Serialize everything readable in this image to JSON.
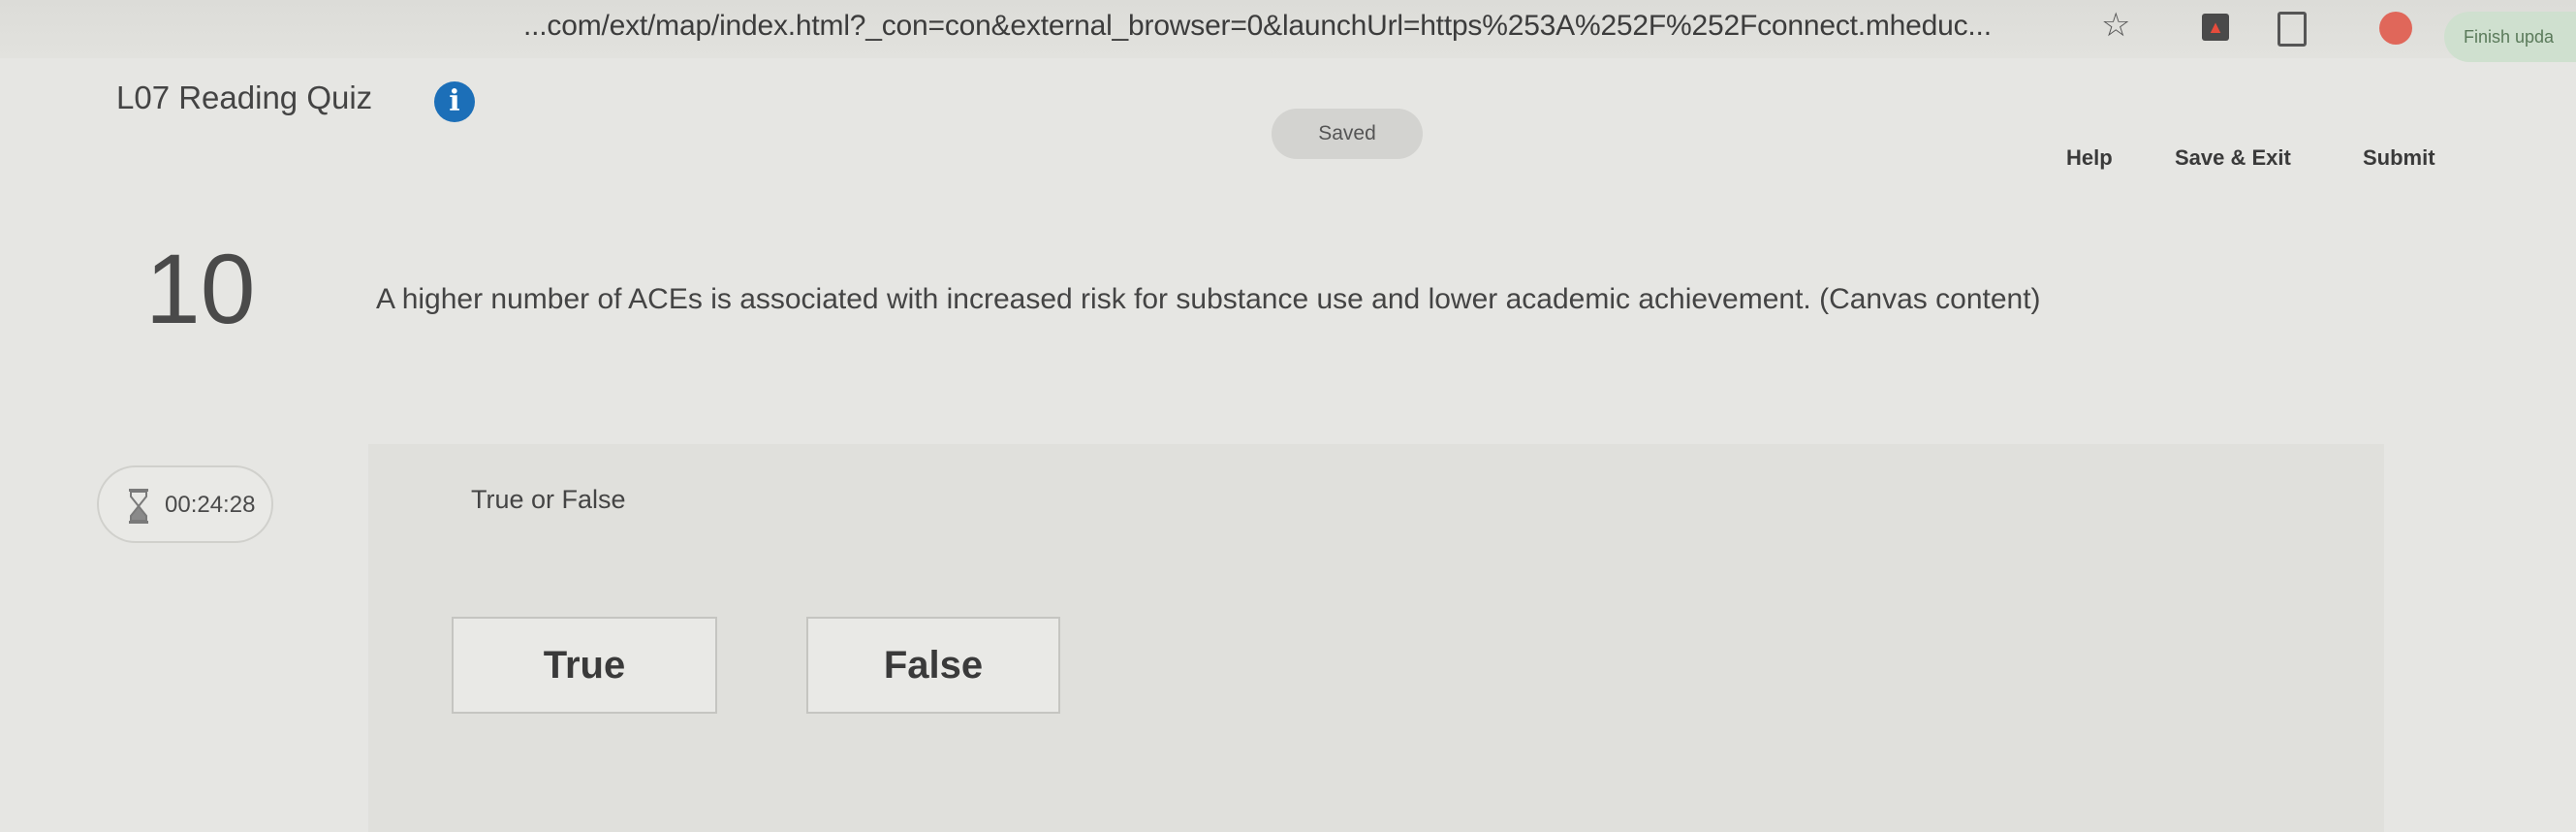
{
  "browser": {
    "url": "...com/ext/map/index.html?_con=con&external_browser=0&launchUrl=https%253A%252F%252Fconnect.mheduc...",
    "finish_update": "Finish upda"
  },
  "header": {
    "quiz_title": "L07 Reading Quiz",
    "info_icon": "i",
    "saved_status": "Saved",
    "help_label": "Help",
    "save_exit_label": "Save & Exit",
    "submit_label": "Submit"
  },
  "question": {
    "number": "10",
    "text": "A higher number of ACEs is associated with increased risk for substance use and lower academic achievement. (Canvas content)",
    "type": "True or False",
    "choices": [
      {
        "label": "True"
      },
      {
        "label": "False"
      }
    ]
  },
  "timer": {
    "value": "00:24:28",
    "icon": "hourglass-icon"
  },
  "colors": {
    "info_blue": "#1c6fb8",
    "background": "#e6e6e3"
  }
}
